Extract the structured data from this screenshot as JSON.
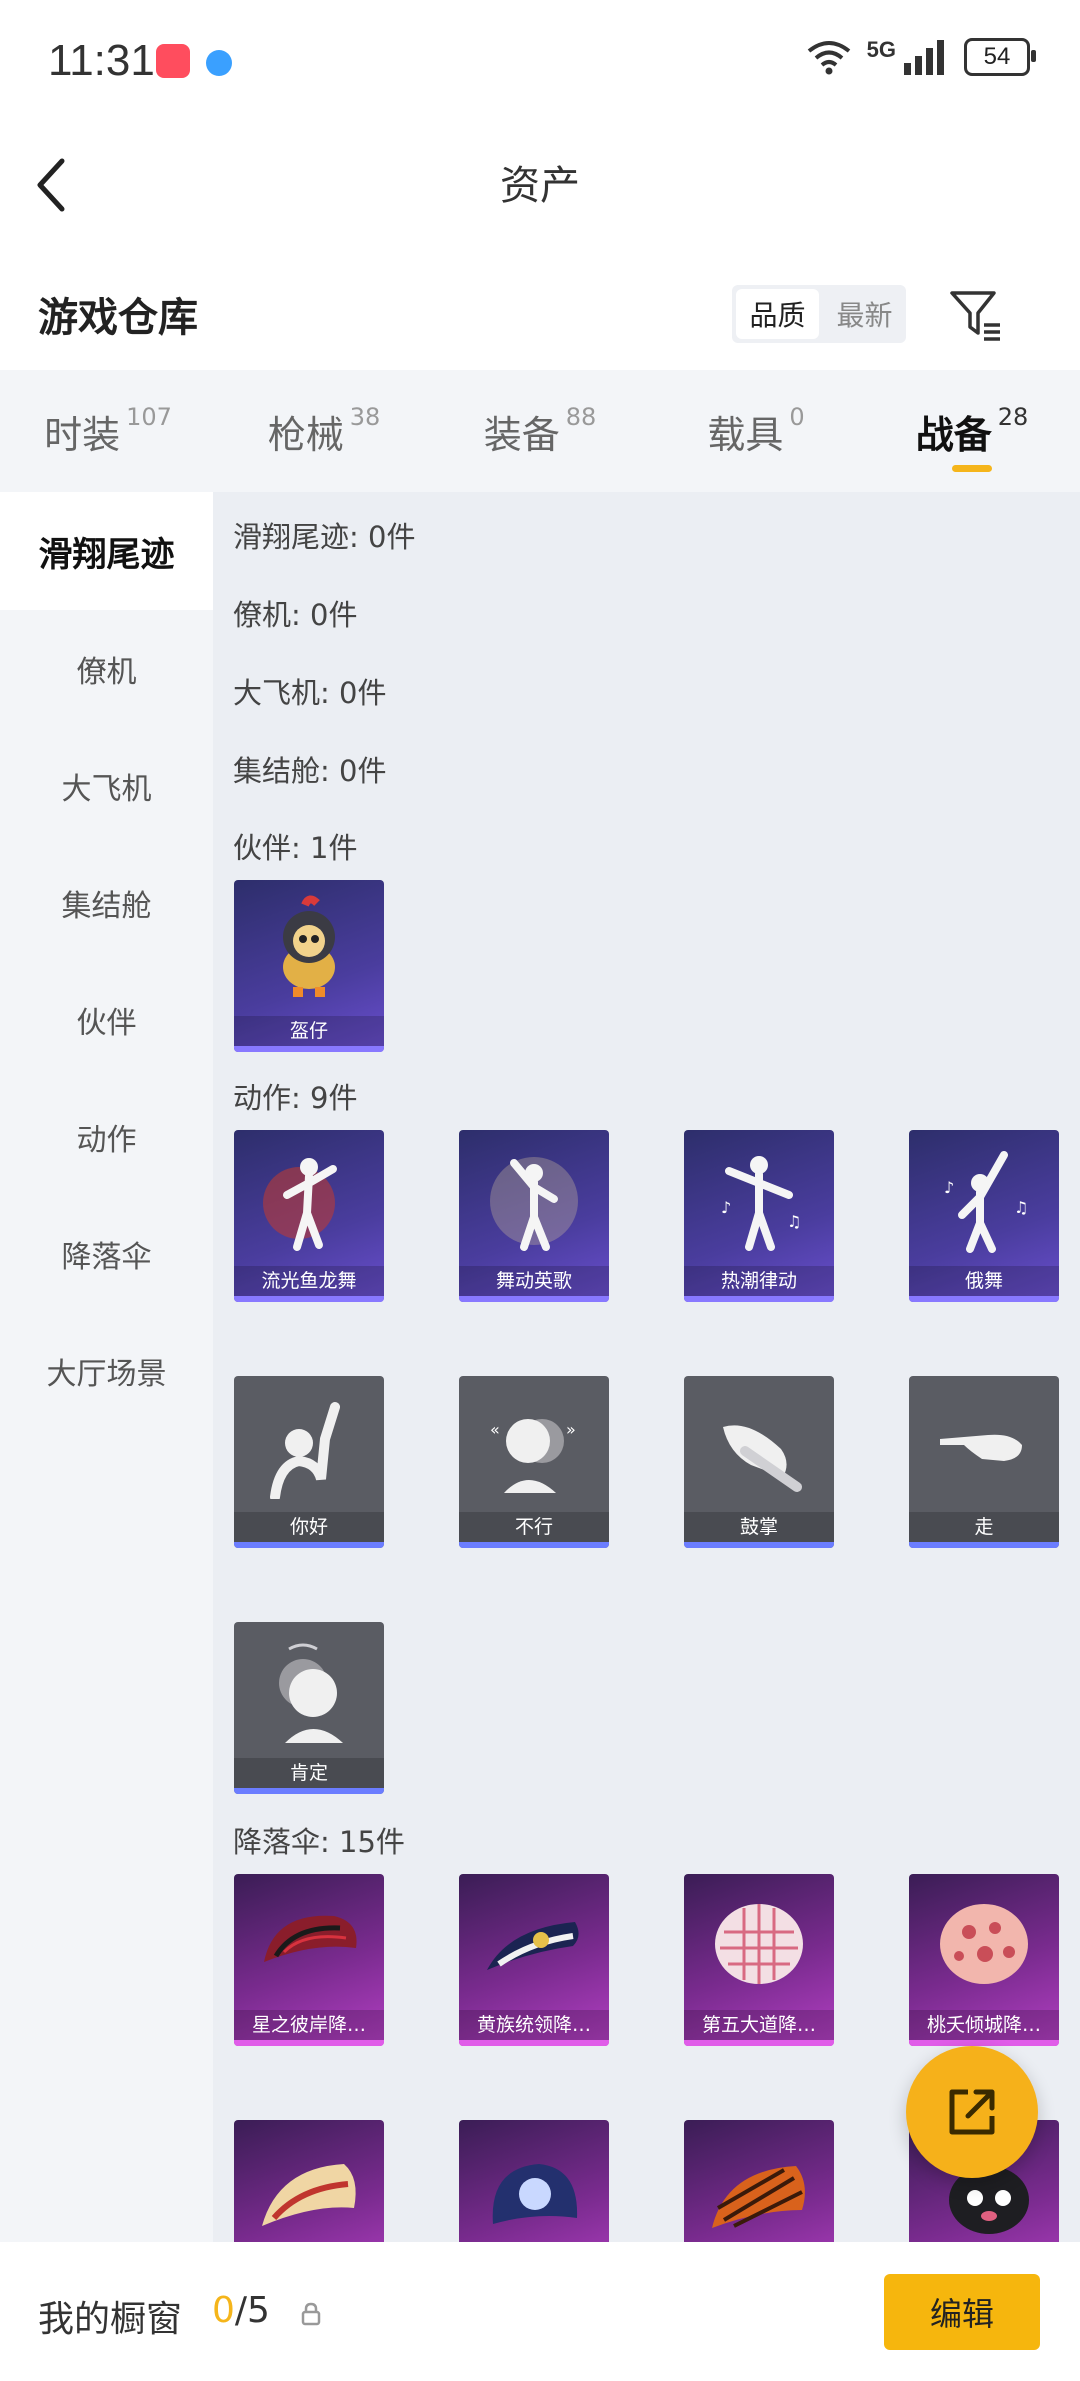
{
  "status_bar": {
    "time": "11:31",
    "network": "5G",
    "battery": "54"
  },
  "nav": {
    "title": "资产"
  },
  "header": {
    "title": "游戏仓库",
    "sort_options": [
      "品质",
      "最新"
    ],
    "sort_selected": "品质"
  },
  "tabs": [
    {
      "label": "时装",
      "count": "107"
    },
    {
      "label": "枪械",
      "count": "38"
    },
    {
      "label": "装备",
      "count": "88"
    },
    {
      "label": "载具",
      "count": "0"
    },
    {
      "label": "战备",
      "count": "28",
      "active": true
    }
  ],
  "sidebar": {
    "items": [
      "滑翔尾迹",
      "僚机",
      "大飞机",
      "集结舱",
      "伙伴",
      "动作",
      "降落伞",
      "大厅场景"
    ],
    "active": "滑翔尾迹"
  },
  "sections": {
    "glide": "滑翔尾迹: 0件",
    "wingman": "僚机: 0件",
    "bigplane": "大飞机: 0件",
    "pod": "集结舱: 0件",
    "partner": "伙伴: 1件",
    "emote": "动作: 9件",
    "parachute": "降落伞: 15件"
  },
  "partner_items": [
    "盔仔"
  ],
  "emote_items": [
    "流光鱼龙舞",
    "舞动英歌",
    "热潮律动",
    "俄舞",
    "你好",
    "不行",
    "鼓掌",
    "走",
    "肯定"
  ],
  "parachute_items": [
    "星之彼岸降…",
    "黄族统领降…",
    "第五大道降…",
    "桃夭倾城降…"
  ],
  "bottom": {
    "label": "我的橱窗",
    "used": "0",
    "total": "/5",
    "edit": "编辑"
  },
  "colors": {
    "accent": "#f5b51b",
    "purple_card": "#4a3d9e",
    "gray_card": "#5a5c63",
    "magenta_card": "#7a2b8f"
  }
}
